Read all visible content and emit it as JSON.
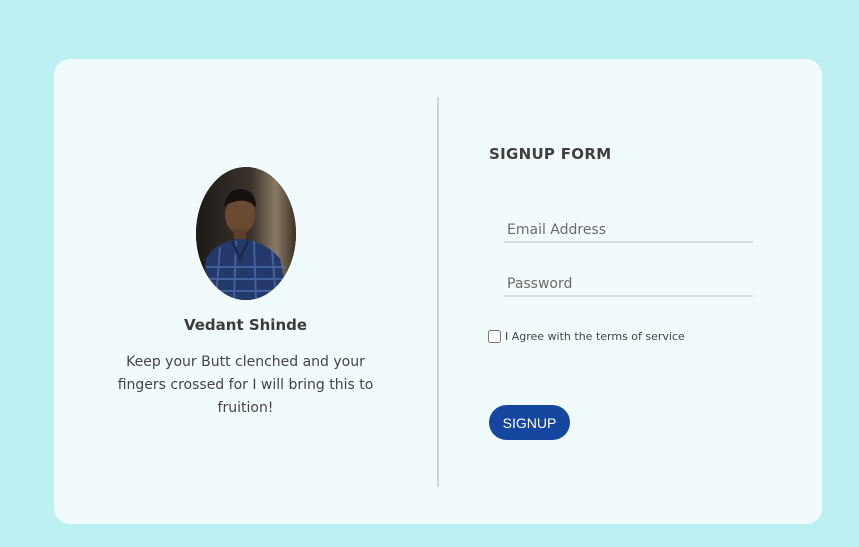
{
  "profile": {
    "name": "Vedant Shinde",
    "quote": "Keep your Butt clenched and your fingers crossed for I will bring this to fruition!",
    "avatar_icon": "profile-photo"
  },
  "form": {
    "title": "SIGNUP FORM",
    "email_placeholder": "Email Address",
    "password_placeholder": "Password",
    "agree_label": "I Agree with the terms of service",
    "signup_label": "SIGNUP"
  },
  "colors": {
    "background": "#bdf0f3",
    "card": "#f2fbfc",
    "button": "#1546a0"
  }
}
